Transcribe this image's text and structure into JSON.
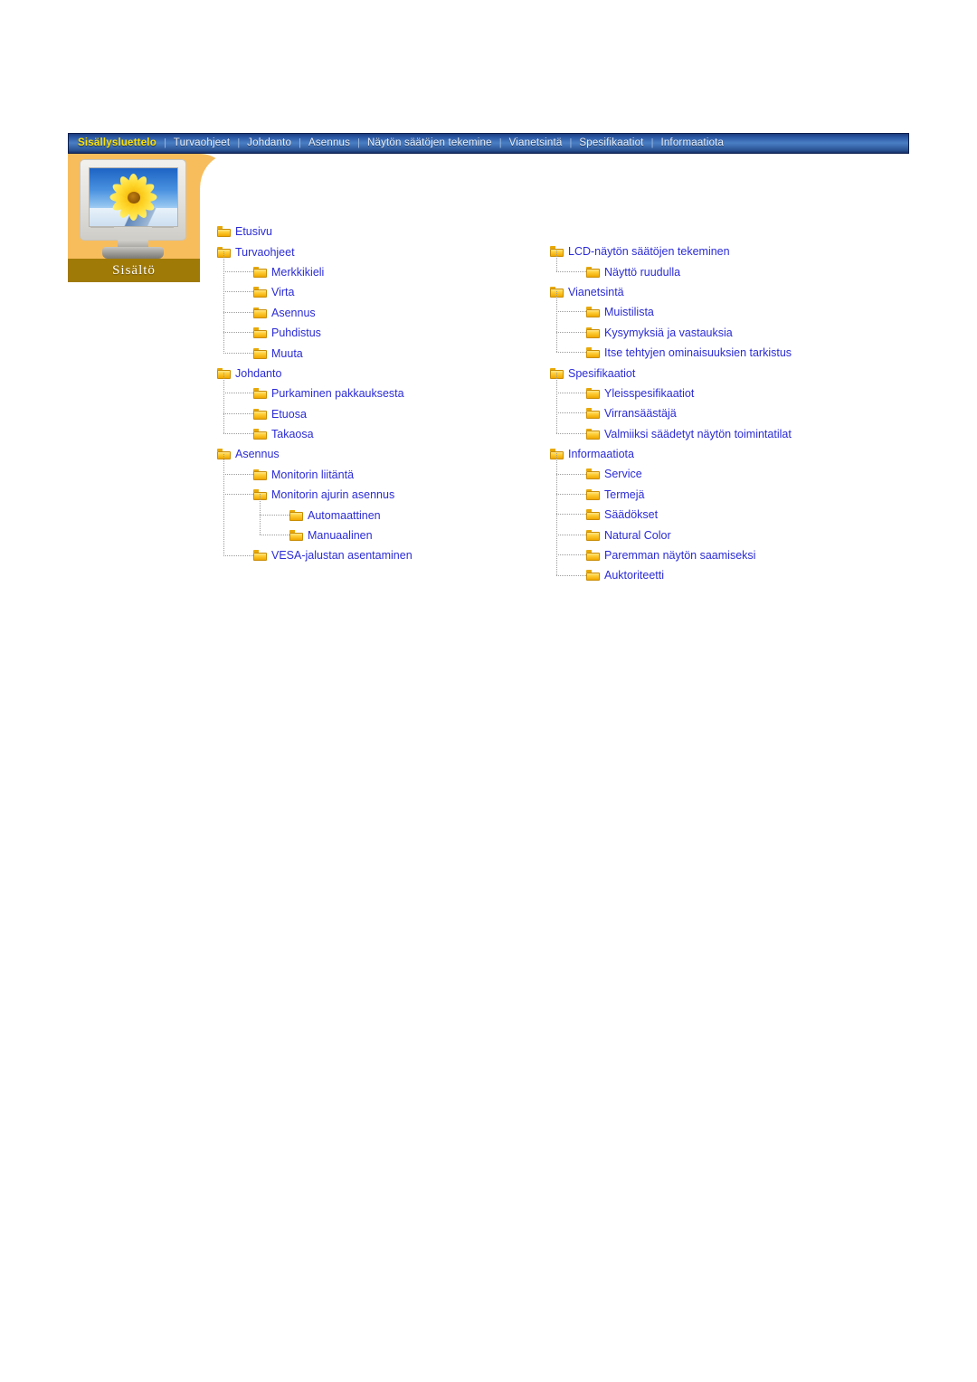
{
  "nav": {
    "items": [
      {
        "label": "Sisällysluettelo",
        "active": true
      },
      {
        "label": "Turvaohjeet",
        "active": false
      },
      {
        "label": "Johdanto",
        "active": false
      },
      {
        "label": "Asennus",
        "active": false
      },
      {
        "label": "Näytön säätöjen tekemine",
        "active": false
      },
      {
        "label": "Vianetsintä",
        "active": false
      },
      {
        "label": "Spesifikaatiot",
        "active": false
      },
      {
        "label": "Informaatiota",
        "active": false
      }
    ],
    "separator": "|"
  },
  "sidebar": {
    "caption": "Sisältö",
    "image_alt": "monitor-sunflower"
  },
  "colors": {
    "nav_active_text": "#ffe100",
    "nav_text": "#e8eef8",
    "panel_orange": "#f7bd5d",
    "caption_bar": "#a07a06",
    "link_blue": "#2b2bd6",
    "folder_yellow": "#ffcf3a"
  },
  "tree_left": [
    {
      "label": "Etusivu",
      "level": 0
    },
    {
      "label": "Turvaohjeet",
      "level": 0
    },
    {
      "label": "Merkkikieli",
      "level": 1
    },
    {
      "label": "Virta",
      "level": 1
    },
    {
      "label": "Asennus",
      "level": 1
    },
    {
      "label": "Puhdistus",
      "level": 1
    },
    {
      "label": "Muuta",
      "level": 1
    },
    {
      "label": "Johdanto",
      "level": 0
    },
    {
      "label": "Purkaminen pakkauksesta",
      "level": 1
    },
    {
      "label": "Etuosa",
      "level": 1
    },
    {
      "label": "Takaosa",
      "level": 1
    },
    {
      "label": "Asennus",
      "level": 0
    },
    {
      "label": "Monitorin liitäntä",
      "level": 1
    },
    {
      "label": "Monitorin ajurin asennus",
      "level": 1
    },
    {
      "label": "Automaattinen",
      "level": 2
    },
    {
      "label": "Manuaalinen",
      "level": 2
    },
    {
      "label": "VESA-jalustan asentaminen",
      "level": 1
    }
  ],
  "tree_right": [
    {
      "label": "LCD-näytön säätöjen tekeminen",
      "level": 0
    },
    {
      "label": "Näyttö ruudulla",
      "level": 1
    },
    {
      "label": "Vianetsintä",
      "level": 0
    },
    {
      "label": "Muistilista",
      "level": 1
    },
    {
      "label": "Kysymyksiä ja vastauksia",
      "level": 1
    },
    {
      "label": "Itse tehtyjen ominaisuuksien tarkistus",
      "level": 1
    },
    {
      "label": "Spesifikaatiot",
      "level": 0
    },
    {
      "label": "Yleisspesifikaatiot",
      "level": 1
    },
    {
      "label": "Virransäästäjä",
      "level": 1
    },
    {
      "label": "Valmiiksi säädetyt näytön toimintatilat",
      "level": 1
    },
    {
      "label": "Informaatiota",
      "level": 0
    },
    {
      "label": "Service",
      "level": 1
    },
    {
      "label": "Termejä",
      "level": 1
    },
    {
      "label": "Säädökset",
      "level": 1
    },
    {
      "label": "Natural Color",
      "level": 1
    },
    {
      "label": "Paremman näytön saamiseksi",
      "level": 1
    },
    {
      "label": "Auktoriteetti",
      "level": 1
    }
  ]
}
